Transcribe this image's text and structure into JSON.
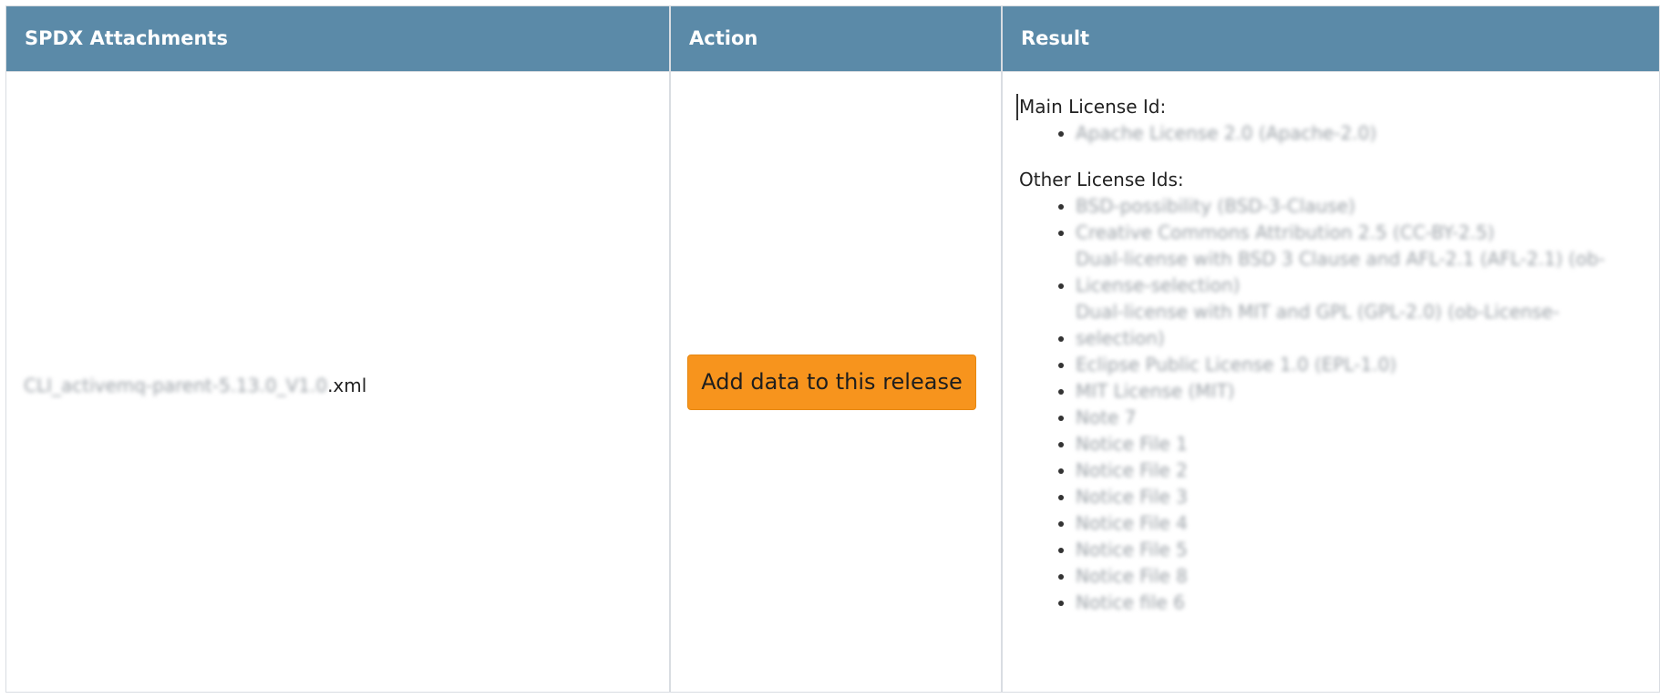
{
  "table": {
    "headers": [
      "SPDX Attachments",
      "Action",
      "Result"
    ]
  },
  "row": {
    "file_name_blurred": "CLI_activemq-parent-5.13.0_V1.0",
    "file_name_suffix": ".xml",
    "action_button_label": "Add data to this release",
    "result": {
      "main_label": "Main License Id:",
      "main_ids": [
        "Apache License 2.0 (Apache-2.0)"
      ],
      "other_label": "Other License Ids:",
      "other_ids": [
        "BSD-possibility (BSD-3-Clause)",
        "Creative Commons Attribution 2.5 (CC-BY-2.5)",
        "Dual-license with BSD 3 Clause and AFL-2.1 (AFL-2.1) (ob-License-selection)",
        "Dual-license with MIT and GPL (GPL-2.0) (ob-License-selection)",
        "Eclipse Public License 1.0 (EPL-1.0)",
        "MIT License (MIT)",
        "Note 7",
        "Notice File 1",
        "Notice File 2",
        "Notice File 3",
        "Notice File 4",
        "Notice File 5",
        "Notice File 8",
        "Notice file 6"
      ]
    }
  },
  "colors": {
    "header_bg": "#5b8aa8",
    "header_text": "#ffffff",
    "button_bg": "#f7941d",
    "border": "#d9dde2"
  }
}
